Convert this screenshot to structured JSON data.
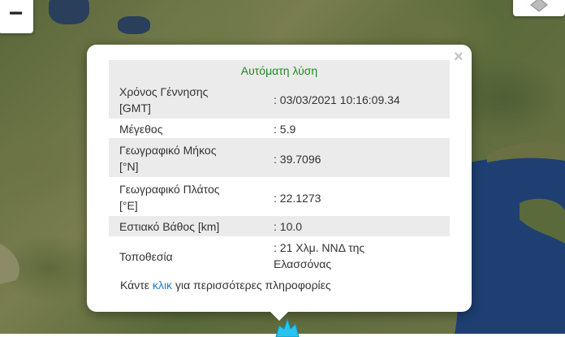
{
  "map": {
    "zoom_out_label": "−",
    "layers_icon": "layers-icon",
    "marker_icon": "earthquake-marker-icon"
  },
  "popup": {
    "title": "Αυτόματη λύση",
    "close_label": "×",
    "rows": [
      {
        "label": "Χρόνος Γέννησης\n[GMT]",
        "value": ": 03/03/2021 10:16:09.34"
      },
      {
        "label": "Μέγεθος",
        "value": ": 5.9"
      },
      {
        "label": "Γεωγραφικό Μήκος\n[°N]",
        "value": ": 39.7096"
      },
      {
        "label": "Γεωγραφικό Πλάτος\n[°E]",
        "value": ": 22.1273"
      },
      {
        "label": "Εστιακό Βάθος [km]",
        "value": ": 10.0"
      },
      {
        "label": "Τοποθεσία",
        "value": ": 21 Χλμ. ΝΝΔ της\nΕλασσόνας"
      }
    ],
    "more_prefix": "Κάντε",
    "more_link": "κλικ",
    "more_suffix": "για περισσότερες πληροφορίες"
  },
  "colors": {
    "title_green": "#1f8a1f",
    "link_blue": "#1e7fd0",
    "sea_blue": "#1f3f73",
    "marker_cyan": "#29c4f0"
  }
}
